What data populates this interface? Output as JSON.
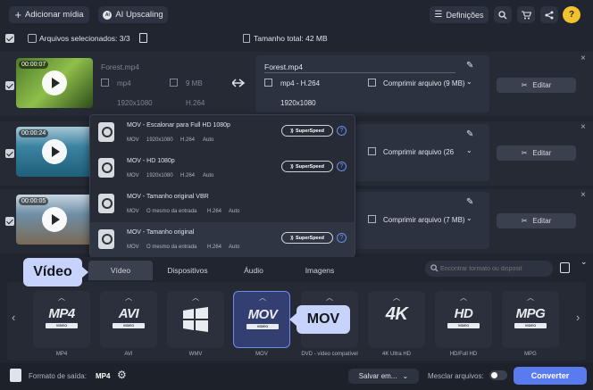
{
  "toolbar": {
    "add_media": "Adicionar mídia",
    "ai_upscaling": "AI Upscaling",
    "settings": "Definições"
  },
  "selection_bar": {
    "selected": "Arquivos selecionados: 3/3",
    "total": "Tamanho total: 42 MB"
  },
  "files": [
    {
      "duration": "00:00:07",
      "name": "Forest.mp4",
      "src_format": "mp4",
      "src_size": "9 MB",
      "src_resolution": "1920x1080",
      "src_codec": "H.264",
      "out_name": "Forest.mp4",
      "out_format": "mp4 - H.264",
      "out_compress": "Comprimir arquivo (9 MB)",
      "out_resolution": "1920x1080",
      "edit": "Editar"
    },
    {
      "duration": "00:00:24",
      "out_compress": "Comprimir arquivo (26",
      "edit": "Editar"
    },
    {
      "duration": "00:00:05",
      "out_compress": "Comprimir arquivo (7 MB)",
      "edit": "Editar"
    }
  ],
  "popup": {
    "items": [
      {
        "title": "MOV - Escalonar para Full HD 1080p",
        "details": [
          "MOV",
          "1920x1080",
          "H.264",
          "Auto"
        ],
        "superspeed": "SuperSpeed"
      },
      {
        "title": "MOV - HD 1080p",
        "details": [
          "MOV",
          "1920x1080",
          "H.264",
          "Auto"
        ],
        "superspeed": "SuperSpeed"
      },
      {
        "title": "MOV - Tamanho original VBR",
        "details": [
          "MOV",
          "O mesmo da entrada",
          "H.264",
          "Auto"
        ],
        "superspeed": ""
      },
      {
        "title": "MOV - Tamanho original",
        "details": [
          "MOV",
          "O mesmo da entrada",
          "H.264",
          "Auto"
        ],
        "superspeed": "SuperSpeed"
      }
    ]
  },
  "tabs": [
    "Vídeo",
    "Dispositivos",
    "Áudio",
    "Imagens"
  ],
  "search": {
    "placeholder": "Encontrar formato ou disposit"
  },
  "callouts": {
    "video": "Vídeo",
    "mov": "MOV"
  },
  "formats": [
    {
      "label": "MP4",
      "sub": "VIDEO",
      "name": "MP4"
    },
    {
      "label": "AVI",
      "sub": "VIDEO",
      "name": "AVI"
    },
    {
      "label": "",
      "sub": "",
      "name": "WMV"
    },
    {
      "label": "MOV",
      "sub": "VIDEO",
      "name": "MOV"
    },
    {
      "label": "",
      "sub": "",
      "name": "DVD - vídeo compatível"
    },
    {
      "label": "4K",
      "sub": "",
      "name": "4K Ultra HD"
    },
    {
      "label": "HD",
      "sub": "VIDEO",
      "name": "HD/Full HD"
    },
    {
      "label": "MPG",
      "sub": "VIDEO",
      "name": "MPG"
    }
  ],
  "footer": {
    "output_label": "Formato de saída:",
    "output_value": "MP4",
    "save": "Salvar em...",
    "merge": "Mesclar arquivos:",
    "convert": "Converter"
  },
  "colors": {
    "accent": "#5a7af0",
    "background": "#20252f",
    "panel": "#2c3240"
  }
}
